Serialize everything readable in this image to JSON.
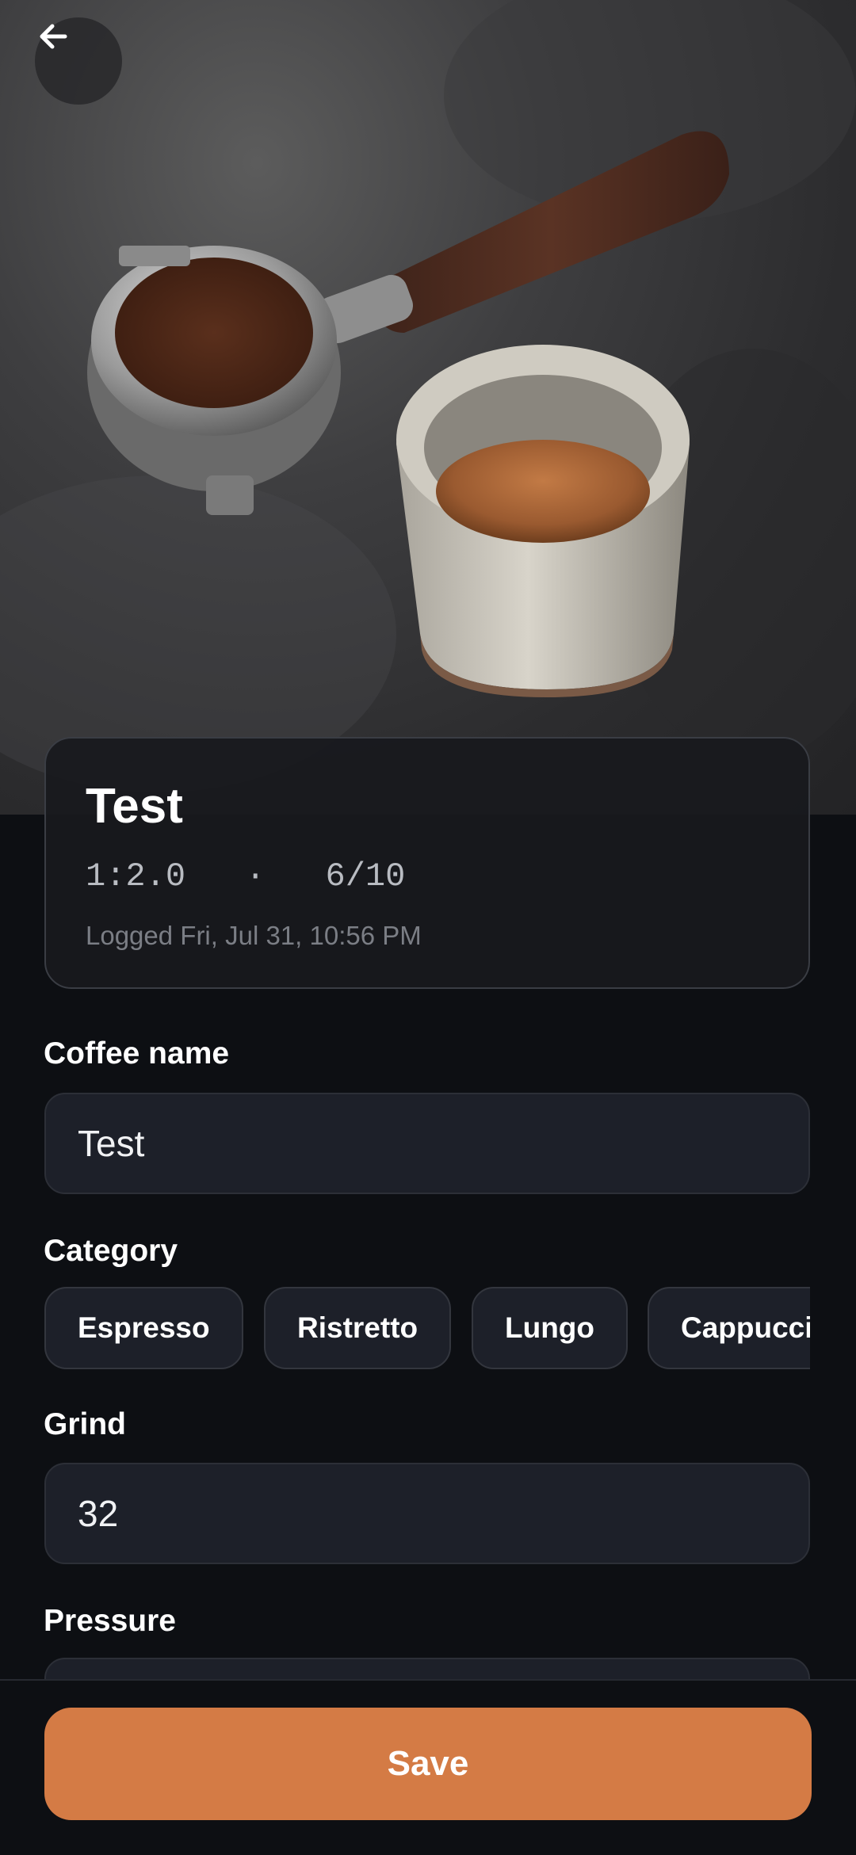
{
  "header": {
    "back_icon": "arrow-left-icon",
    "hero_image": "espresso-portafilter-and-cup-photo"
  },
  "summary": {
    "title": "Test",
    "ratio": "1:2.0",
    "separator": "·",
    "rating": "6/10",
    "logged": "Logged Fri, Jul 31, 10:56 PM"
  },
  "form": {
    "coffee_name": {
      "label": "Coffee name",
      "value": "Test"
    },
    "category": {
      "label": "Category",
      "options": [
        "Espresso",
        "Ristretto",
        "Lungo",
        "Cappuccino"
      ]
    },
    "grind": {
      "label": "Grind",
      "value": "32"
    },
    "pressure": {
      "label": "Pressure",
      "value": ""
    }
  },
  "actions": {
    "save_label": "Save"
  },
  "colors": {
    "background": "#0d0f13",
    "surface": "#1d2029",
    "accent": "#d47b45"
  }
}
